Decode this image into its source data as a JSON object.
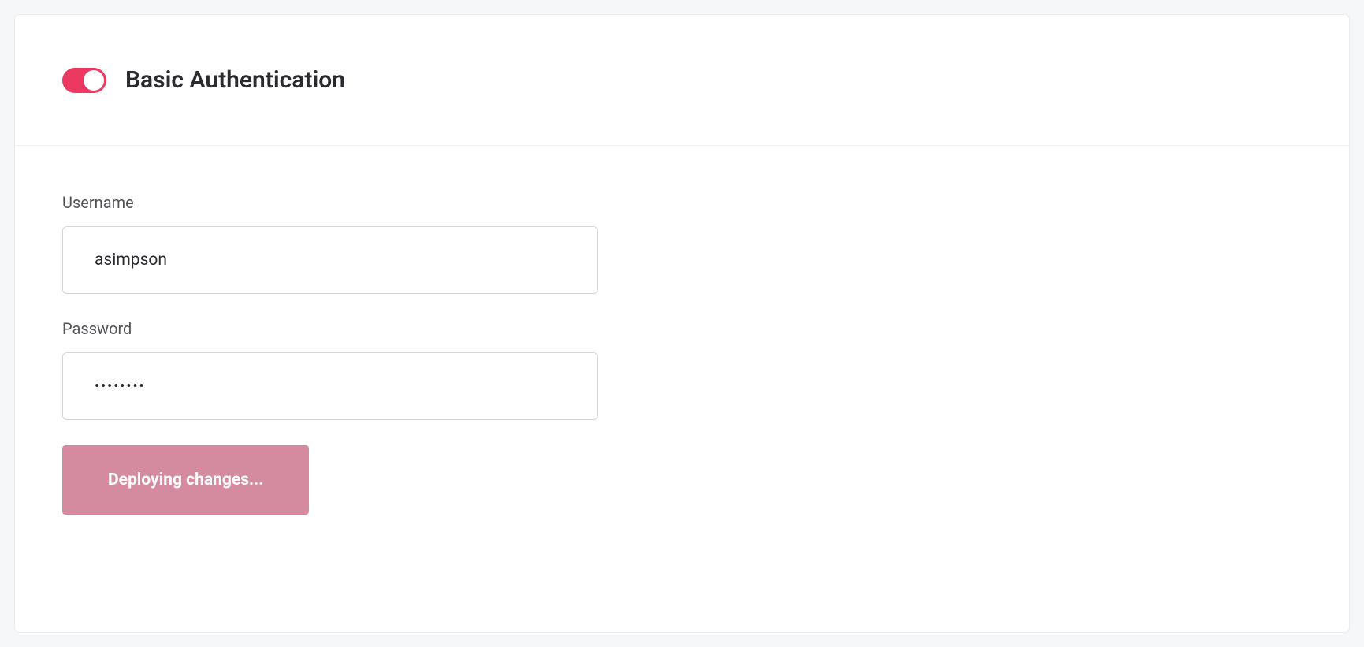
{
  "header": {
    "title": "Basic Authentication",
    "toggle_on": true
  },
  "form": {
    "username_label": "Username",
    "username_value": "asimpson",
    "password_label": "Password",
    "password_value": "••••••••"
  },
  "actions": {
    "deploy_label": "Deploying changes..."
  },
  "colors": {
    "accent": "#eb3962",
    "button_bg": "#d58b9f"
  }
}
